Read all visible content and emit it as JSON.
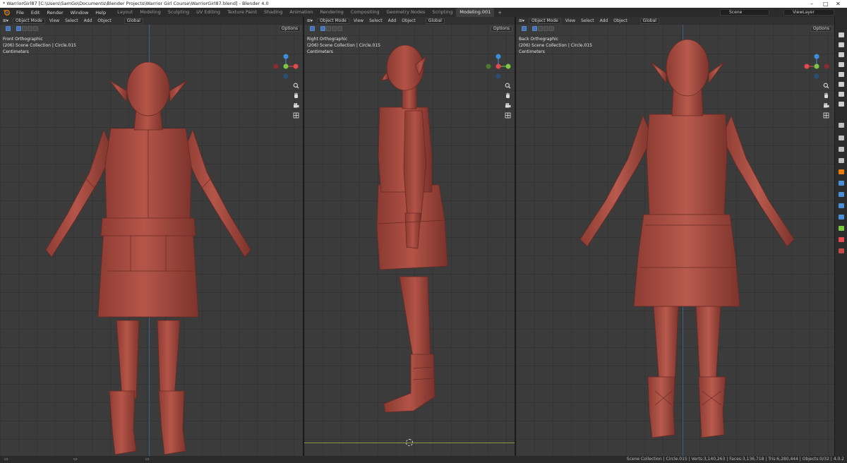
{
  "window": {
    "title": "* WarriorGirl87 [C:\\Users\\SamGo\\Documents\\Blender Projects\\Warrior Girl Course\\WarriorGirl87.blend] - Blender 4.0"
  },
  "menu": [
    "File",
    "Edit",
    "Render",
    "Window",
    "Help"
  ],
  "workspaces": [
    "Layout",
    "Modeling",
    "Sculpting",
    "UV Editing",
    "Texture Paint",
    "Shading",
    "Animation",
    "Rendering",
    "Compositing",
    "Geometry Nodes",
    "Scripting",
    "Modeling.001"
  ],
  "active_workspace": "Modeling.001",
  "scene": {
    "label": "Scene",
    "view_layer": "ViewLayer"
  },
  "viewport_header": {
    "mode": "Object Mode",
    "view": "View",
    "select": "Select",
    "add": "Add",
    "object": "Object",
    "orientation": "Global",
    "options": "Options"
  },
  "viewports": [
    {
      "view_name": "Front Orthographic",
      "collection": "(206) Scene Collection | Circle.015",
      "units": "Centimeters"
    },
    {
      "view_name": "Right Orthographic",
      "collection": "(206) Scene Collection | Circle.015",
      "units": "Centimeters"
    },
    {
      "view_name": "Back Orthographic",
      "collection": "(206) Scene Collection | Circle.015",
      "units": "Centimeters"
    }
  ],
  "gizmo_axes": {
    "x": "X",
    "y": "Y",
    "z": "Z"
  },
  "status": {
    "text": "Scene Collection | Circle.015 | Verts:3,140,263 | Faces:3,136,718 | Tris:6,280,444 | Objects:0/32 | 4.0.2"
  },
  "colors": {
    "clay": "#a54a40",
    "accent": "#4772b3",
    "x_axis": "#e5484d",
    "y_axis": "#7ac943",
    "z_axis": "#3c8fe0"
  }
}
